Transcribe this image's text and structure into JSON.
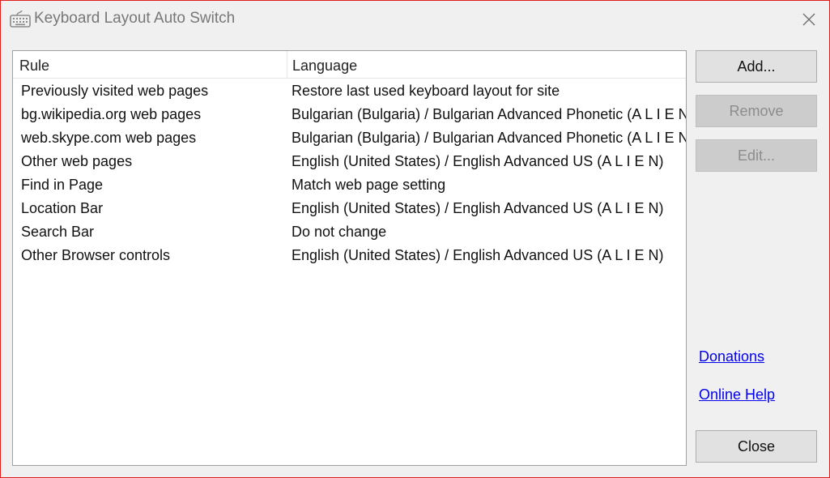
{
  "window": {
    "title": "Keyboard Layout Auto Switch",
    "close_icon": "close-icon",
    "app_icon": "keyboard-icon"
  },
  "list": {
    "columns": [
      "Rule",
      "Language"
    ],
    "rows": [
      {
        "rule": "Previously visited web pages",
        "language": "Restore last used keyboard layout for site"
      },
      {
        "rule": "bg.wikipedia.org web pages",
        "language": "Bulgarian (Bulgaria) / Bulgarian Advanced Phonetic (A L I E N)"
      },
      {
        "rule": "web.skype.com web pages",
        "language": "Bulgarian (Bulgaria) / Bulgarian Advanced Phonetic (A L I E N)"
      },
      {
        "rule": "Other web pages",
        "language": "English (United States) / English Advanced US (A L I E N)"
      },
      {
        "rule": "Find in Page",
        "language": "Match web page setting"
      },
      {
        "rule": "Location Bar",
        "language": "English (United States) / English Advanced US (A L I E N)"
      },
      {
        "rule": "Search Bar",
        "language": "Do not change"
      },
      {
        "rule": "Other Browser controls",
        "language": "English (United States) / English Advanced US (A L I E N)"
      }
    ]
  },
  "buttons": {
    "add": "Add...",
    "remove": "Remove",
    "edit": "Edit...",
    "close": "Close"
  },
  "links": {
    "donations": "Donations",
    "online_help": "Online Help"
  },
  "colors": {
    "window_border": "#e01f1f",
    "link": "#0000ee",
    "disabled_text": "#8c8c8c"
  }
}
